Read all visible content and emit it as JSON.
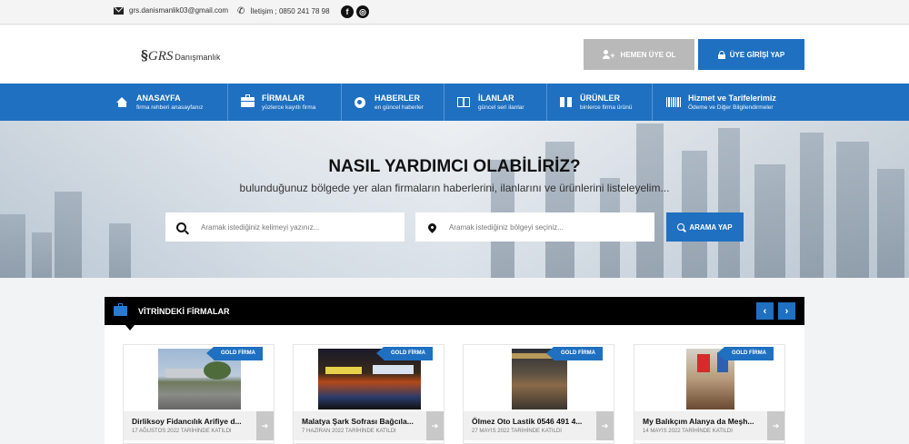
{
  "topbar": {
    "email": "grs.danismanlik03@gmail.com",
    "phone": "İletişim ; 0850 241 78 98",
    "email_icon": "envelope-icon",
    "phone_icon": "phone-icon",
    "facebook_glyph": "f",
    "instagram_glyph": "◎"
  },
  "header": {
    "logo_mark": "§",
    "logo_big": "GRS",
    "logo_small": "Danışmanlık",
    "member_button": "HEMEN ÜYE OL",
    "login_button": "ÜYE GİRİŞİ YAP"
  },
  "nav": {
    "items": [
      {
        "title": "ANASAYFA",
        "subtitle": "firma rehberi anasayfanız",
        "icon": "home-icon"
      },
      {
        "title": "FİRMALAR",
        "subtitle": "yüzlerce kayıtlı firma",
        "icon": "briefcase-icon"
      },
      {
        "title": "HABERLER",
        "subtitle": "en güncel haberler",
        "icon": "globe-icon"
      },
      {
        "title": "İLANLAR",
        "subtitle": "güncel seri ilanlar",
        "icon": "columns-icon"
      },
      {
        "title": "ÜRÜNLER",
        "subtitle": "binlerce firma ürünü",
        "icon": "gift-icon"
      },
      {
        "title": "Hizmet ve Tarifelerimiz",
        "subtitle": "Ödeme ve Diğer Bilgilendirmeler",
        "icon": "barcode-icon"
      }
    ]
  },
  "hero": {
    "title": "NASIL YARDIMCI OLABİLİRİZ?",
    "subtitle": "bulunduğunuz bölgede yer alan firmaların haberlerini, ilanlarını ve ürünlerini listeleyelim...",
    "keyword_placeholder": "Aramak istediğiniz kelimeyi yazınız...",
    "region_placeholder": "Aramak istediğiniz bölgeyi seçiniz...",
    "search_button": "ARAMA YAP"
  },
  "showcase": {
    "title": "VİTRİNDEKİ FİRMALAR",
    "prev": "‹",
    "next": "›",
    "cards": [
      {
        "badge": "GOLD FİRMA",
        "name": "Dirliksoy Fidancılık Arifiye d...",
        "date": "17 AĞUSTOS 2022 TARİHİNDE KATILDI",
        "go": "➔"
      },
      {
        "badge": "GOLD FİRMA",
        "name": "Malatya Şark Sofrası Bağcıla...",
        "date": "7 HAZİRAN 2022 TARİHİNDE KATILDI",
        "go": "➔"
      },
      {
        "badge": "GOLD FİRMA",
        "name": "Ölmez Oto Lastik 0546 491 4...",
        "date": "27 MAYIS 2022 TARİHİNDE KATILDI",
        "go": "➔"
      },
      {
        "badge": "GOLD FİRMA",
        "name": "My Balıkçım Alanya da Meşh...",
        "date": "14 MAYIS 2022 TARİHİNDE KATILDI",
        "go": "➔"
      }
    ]
  },
  "colors": {
    "primary": "#1f70c1",
    "button_gray": "#b9b9b9",
    "dark": "#000000"
  }
}
